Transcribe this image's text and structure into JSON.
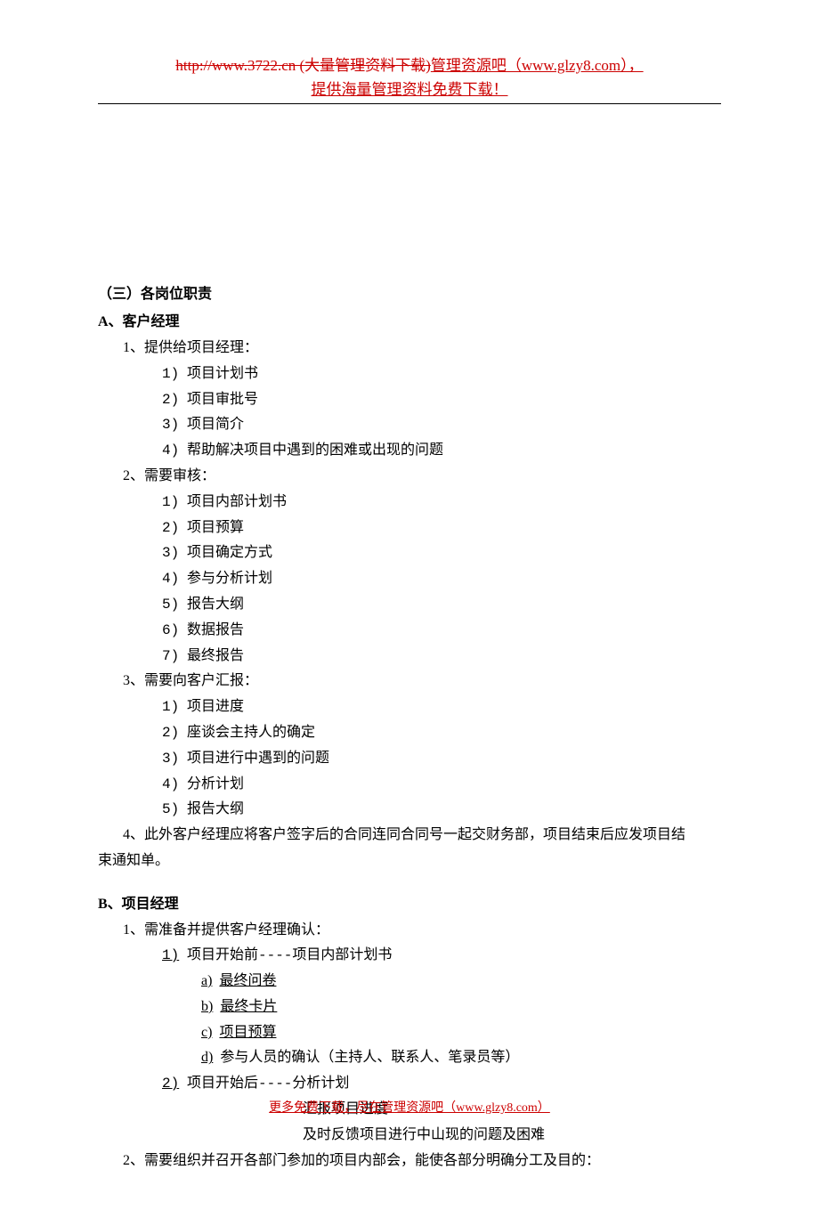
{
  "header": {
    "strikeout": "http://www.3722.cn (大量管理资料下载)",
    "after": "管理资源吧（www.glzy8.com），",
    "line2": "提供海量管理资料免费下载！"
  },
  "sec3_title": "（三）各岗位职责",
  "sectionA": {
    "title": "A、客户经理",
    "item1_label": "1、提供给项目经理：",
    "item1_list": {
      "n1": "1)",
      "t1": "项目计划书",
      "n2": "2)",
      "t2": "项目审批号",
      "n3": "3)",
      "t3": "项目简介",
      "n4": "4)",
      "t4": "帮助解决项目中遇到的困难或出现的问题"
    },
    "item2_label": "2、需要审核：",
    "item2_list": {
      "n1": "1)",
      "t1": "项目内部计划书",
      "n2": "2)",
      "t2": "项目预算",
      "n3": "3)",
      "t3": "项目确定方式",
      "n4": "4)",
      "t4": "参与分析计划",
      "n5": "5)",
      "t5": "报告大纲",
      "n6": "6)",
      "t6": "数据报告",
      "n7": "7)",
      "t7": "最终报告"
    },
    "item3_label": "3、需要向客户汇报：",
    "item3_list": {
      "n1": "1)",
      "t1": "项目进度",
      "n2": "2)",
      "t2": "座谈会主持人的确定",
      "n3": "3)",
      "t3": "项目进行中遇到的问题",
      "n4": "4)",
      "t4": "分析计划",
      "n5": "5)",
      "t5": "报告大纲"
    },
    "item4_text_a": "4、此外客户经理应将客户签字后的合同连同合同号一起交财务部，项目结束后应发项目结",
    "item4_text_b": "束通知单。"
  },
  "sectionB": {
    "title": "B、项目经理",
    "item1_label": "1、需准备并提供客户经理确认：",
    "item1_list": {
      "n1": "1)",
      "t1": "项目开始前----项目内部计划书",
      "sub_a_n": "a)",
      "sub_a_t": "最终问卷",
      "sub_b_n": "b)",
      "sub_b_t": "最终卡片",
      "sub_c_n": "c)",
      "sub_c_t": "项目预算",
      "sub_d_n": "d)",
      "sub_d_t": "参与人员的确认（主持人、联系人、笔录员等）",
      "n2": "2)",
      "t2": "项目开始后----分析计划",
      "sub2_a": "汇报项目进度",
      "sub2_b": "及时反馈项目进行中山现的问题及困难"
    },
    "item2_label": "2、需要组织并召开各部门参加的项目内部会，能使各部分明确分工及目的："
  },
  "footer": "更多免费下载，尽在管理资源吧（www.glzy8.com）"
}
